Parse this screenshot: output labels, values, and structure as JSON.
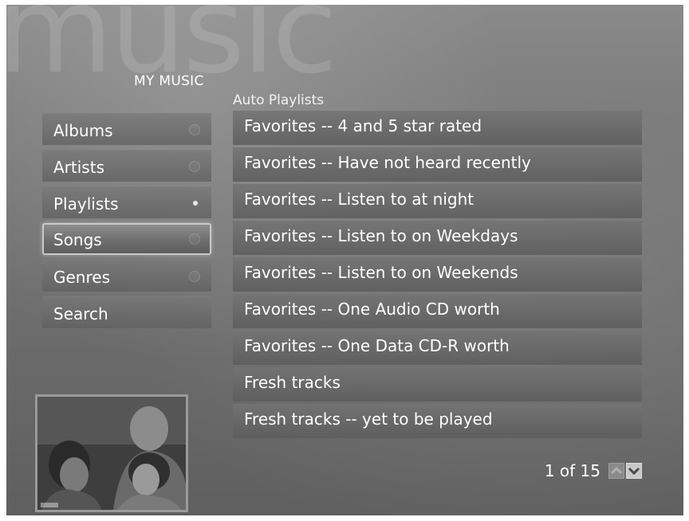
{
  "header": {
    "watermark": "music",
    "section_title": "MY MUSIC"
  },
  "nav": {
    "items": [
      {
        "label": "Albums"
      },
      {
        "label": "Artists"
      },
      {
        "label": "Playlists"
      },
      {
        "label": "Songs"
      },
      {
        "label": "Genres"
      },
      {
        "label": "Search"
      }
    ],
    "selected": "Songs",
    "active_indicator": "Playlists"
  },
  "list": {
    "title": "Auto Playlists",
    "items": [
      {
        "label": "Favorites -- 4 and 5 star rated"
      },
      {
        "label": "Favorites -- Have not heard recently"
      },
      {
        "label": "Favorites -- Listen to at night"
      },
      {
        "label": "Favorites -- Listen to on Weekdays"
      },
      {
        "label": "Favorites -- Listen to on Weekends"
      },
      {
        "label": "Favorites -- One Audio CD worth"
      },
      {
        "label": "Favorites -- One Data CD-R worth"
      },
      {
        "label": "Fresh tracks"
      },
      {
        "label": "Fresh tracks -- yet to be played"
      }
    ]
  },
  "pager": {
    "indicator": "1 of 15",
    "up_icon": "chevron-up-icon",
    "down_icon": "chevron-down-icon"
  },
  "now_playing": {
    "content": "live video thumbnail"
  },
  "colors": {
    "background": "#747474",
    "text": "#ffffff",
    "selection_border": "#c9c9c9"
  }
}
